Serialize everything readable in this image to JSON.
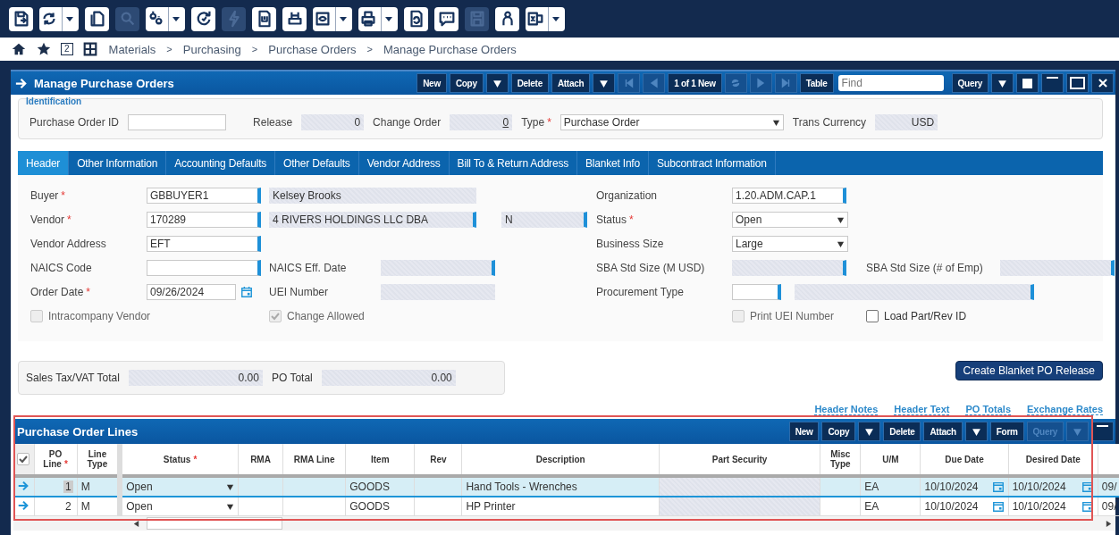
{
  "toolbar": [
    {
      "dropdown": false,
      "disabled": false
    },
    {
      "dropdown": true,
      "disabled": false
    },
    {
      "dropdown": false,
      "disabled": false
    },
    {
      "dropdown": false,
      "disabled": true
    },
    {
      "dropdown": true,
      "disabled": false
    },
    {
      "dropdown": false,
      "disabled": false
    },
    {
      "dropdown": false,
      "disabled": true
    },
    {
      "dropdown": false,
      "disabled": false
    },
    {
      "dropdown": false,
      "disabled": false
    },
    {
      "dropdown": true,
      "disabled": false
    },
    {
      "dropdown": true,
      "disabled": false
    },
    {
      "dropdown": false,
      "disabled": false
    },
    {
      "dropdown": false,
      "disabled": false
    },
    {
      "dropdown": false,
      "disabled": true
    },
    {
      "dropdown": false,
      "disabled": false
    },
    {
      "dropdown": true,
      "disabled": false
    }
  ],
  "breadcrumb": {
    "open_windows": "2",
    "items": [
      {
        "kind": "link",
        "text": "Materials"
      },
      {
        "kind": "sep",
        "text": ">"
      },
      {
        "kind": "link",
        "text": "Purchasing"
      },
      {
        "kind": "sep",
        "text": ">"
      },
      {
        "kind": "link",
        "text": "Purchase Orders"
      },
      {
        "kind": "sep",
        "text": ">"
      },
      {
        "kind": "link",
        "text": "Manage Purchase Orders"
      }
    ]
  },
  "window": {
    "title": "Manage Purchase Orders",
    "controls": [
      {
        "kind": "button",
        "label": "New",
        "disabled": false
      },
      {
        "kind": "button",
        "label": "Copy",
        "disabled": false
      },
      {
        "kind": "caret",
        "disabled": false
      },
      {
        "kind": "button",
        "label": "Delete",
        "disabled": false
      },
      {
        "kind": "button",
        "label": "Attach",
        "disabled": false
      },
      {
        "kind": "caret",
        "disabled": false
      },
      {
        "kind": "first",
        "disabled": true
      },
      {
        "kind": "prev",
        "disabled": true
      },
      {
        "kind": "button",
        "label": "1 of 1 New",
        "disabled": false
      },
      {
        "kind": "refresh",
        "disabled": true
      },
      {
        "kind": "next",
        "disabled": true
      },
      {
        "kind": "last",
        "disabled": true
      },
      {
        "kind": "button",
        "label": "Table",
        "disabled": false
      },
      {
        "kind": "find",
        "placeholder": "Find",
        "disabled": false
      },
      {
        "kind": "button",
        "label": "Query",
        "disabled": false
      },
      {
        "kind": "caret",
        "disabled": false
      },
      {
        "kind": "stop",
        "disabled": false
      },
      {
        "kind": "minimize",
        "disabled": false
      },
      {
        "kind": "maximize",
        "disabled": false
      },
      {
        "kind": "close",
        "disabled": false
      }
    ]
  },
  "identification": {
    "legend": "Identification",
    "items": [
      {
        "kind": "label",
        "text": "Purchase Order ID"
      },
      {
        "kind": "input"
      },
      {
        "kind": "label",
        "text": "Release"
      },
      {
        "kind": "readonly",
        "value": "0"
      },
      {
        "kind": "label",
        "text": "Change Order"
      },
      {
        "kind": "link",
        "value": "0"
      },
      {
        "kind": "label",
        "text": "Type",
        "required_mark": "*"
      },
      {
        "kind": "select",
        "value": "Purchase Order"
      },
      {
        "kind": "label",
        "text": "Trans Currency"
      },
      {
        "kind": "readonly",
        "value": "USD"
      }
    ]
  },
  "tabs": [
    {
      "label": "Header",
      "selected": true
    },
    {
      "label": "Other Information",
      "selected": false
    },
    {
      "label": "Accounting Defaults",
      "selected": false
    },
    {
      "label": "Other Defaults",
      "selected": false
    },
    {
      "label": "Vendor Address",
      "selected": false
    },
    {
      "label": "Bill To & Return Address",
      "selected": false
    },
    {
      "label": "Blanket Info",
      "selected": false
    },
    {
      "label": "Subcontract Information",
      "selected": false
    }
  ],
  "header_form": {
    "left": [
      {
        "kind": "label",
        "text": "Buyer",
        "required_mark": "*"
      },
      {
        "kind": "input",
        "value": "GBBUYER1",
        "lookup": true
      },
      {
        "kind": "display",
        "value": "Kelsey Brooks",
        "lookup": false
      },
      {
        "kind": "gap"
      },
      {
        "kind": "label",
        "text": "Vendor",
        "required_mark": "*"
      },
      {
        "kind": "input",
        "value": "170289",
        "lookup": true
      },
      {
        "kind": "display",
        "value": "4 RIVERS HOLDINGS LLC DBA",
        "lookup": true
      },
      {
        "kind": "readonly",
        "value": "N",
        "lookup": true
      },
      {
        "kind": "label",
        "text": "Vendor Address"
      },
      {
        "kind": "input",
        "value": "EFT",
        "lookup": true
      },
      {
        "kind": "gap"
      },
      {
        "kind": "gap"
      },
      {
        "kind": "gap"
      },
      {
        "kind": "label",
        "text": "NAICS Code"
      },
      {
        "kind": "input",
        "lookup": true
      },
      {
        "kind": "label",
        "text": "NAICS Eff. Date"
      },
      {
        "kind": "readonly",
        "lookup": true
      },
      {
        "kind": "gap"
      },
      {
        "kind": "label",
        "text": "Order Date",
        "required_mark": "*"
      },
      {
        "kind": "date",
        "value": "09/26/2024"
      },
      {
        "kind": "label",
        "text": "UEI Number"
      },
      {
        "kind": "readonly",
        "lookup": false
      },
      {
        "kind": "gap"
      },
      {
        "kind": "checkbox",
        "label": "Intracompany Vendor",
        "checked": false,
        "disabled": true
      },
      {
        "kind": "checkbox",
        "label": "Change Allowed",
        "checked": true,
        "disabled": true
      }
    ],
    "right": [
      {
        "kind": "label",
        "text": "Organization"
      },
      {
        "kind": "input",
        "value": "1.20.ADM.CAP.1",
        "lookup": true
      },
      {
        "kind": "gap"
      },
      {
        "kind": "gap"
      },
      {
        "kind": "label",
        "text": "Status",
        "required_mark": "*"
      },
      {
        "kind": "select",
        "value": "Open"
      },
      {
        "kind": "gap"
      },
      {
        "kind": "gap"
      },
      {
        "kind": "label",
        "text": "Business Size"
      },
      {
        "kind": "select",
        "value": "Large"
      },
      {
        "kind": "gap"
      },
      {
        "kind": "gap"
      },
      {
        "kind": "label",
        "text": "SBA Std Size (M USD)"
      },
      {
        "kind": "readonly",
        "lookup": true
      },
      {
        "kind": "label",
        "text": "SBA Std Size (# of Emp)"
      },
      {
        "kind": "readonly",
        "lookup": true
      },
      {
        "kind": "label",
        "text": "Procurement Type"
      },
      {
        "kind": "input",
        "lookup": true
      },
      {
        "kind": "display",
        "lookup": true
      },
      {
        "kind": "gap"
      },
      {
        "kind": "checkbox",
        "label": "Print UEI Number",
        "checked": false,
        "disabled": true
      },
      {
        "kind": "checkbox",
        "label": "Load Part/Rev ID",
        "checked": false,
        "disabled": false
      }
    ]
  },
  "totals": [
    {
      "label": "Sales Tax/VAT Total",
      "value": "0.00"
    },
    {
      "label": "PO Total",
      "value": "0.00"
    }
  ],
  "create_button": "Create Blanket PO Release",
  "links": [
    "Header Notes",
    "Header Text",
    "PO Totals",
    "Exchange Rates"
  ],
  "lines": {
    "title": "Purchase Order Lines",
    "controls": [
      {
        "kind": "button",
        "label": "New",
        "disabled": false
      },
      {
        "kind": "button",
        "label": "Copy",
        "disabled": false
      },
      {
        "kind": "caret",
        "disabled": false
      },
      {
        "kind": "button",
        "label": "Delete",
        "disabled": false
      },
      {
        "kind": "button",
        "label": "Attach",
        "disabled": false
      },
      {
        "kind": "caret",
        "disabled": false
      },
      {
        "kind": "button",
        "label": "Form",
        "disabled": false
      },
      {
        "kind": "button",
        "label": "Query",
        "disabled": true
      },
      {
        "kind": "caret",
        "disabled": true
      },
      {
        "kind": "minimize",
        "disabled": false
      }
    ],
    "select_all_checked": true,
    "columns": [
      {
        "label": "PO Line",
        "required_mark": "*"
      },
      {
        "label": "Line Type"
      },
      {
        "label": "Status",
        "required_mark": "*"
      },
      {
        "label": "RMA"
      },
      {
        "label": "RMA Line"
      },
      {
        "label": "Item"
      },
      {
        "label": "Rev"
      },
      {
        "label": "Description"
      },
      {
        "label": "Part Security"
      },
      {
        "label": "Misc Type"
      },
      {
        "label": "U/M"
      },
      {
        "label": "Due Date"
      },
      {
        "label": "Desired Date"
      }
    ],
    "rows": [
      {
        "selected": true,
        "cells": [
          {
            "kind": "number",
            "value": "1"
          },
          {
            "kind": "text",
            "value": "M"
          },
          {
            "kind": "select",
            "value": "Open"
          },
          {
            "kind": "text"
          },
          {
            "kind": "text"
          },
          {
            "kind": "text",
            "value": "GOODS"
          },
          {
            "kind": "text"
          },
          {
            "kind": "text",
            "value": "Hand Tools - Wrenches"
          },
          {
            "kind": "readonly"
          },
          {
            "kind": "text"
          },
          {
            "kind": "text",
            "value": "EA"
          },
          {
            "kind": "date",
            "value": "10/10/2024"
          },
          {
            "kind": "date",
            "value": "10/10/2024"
          },
          {
            "kind": "text",
            "value": "09/"
          }
        ]
      },
      {
        "selected": false,
        "cells": [
          {
            "kind": "number",
            "value": "2"
          },
          {
            "kind": "text",
            "value": "M"
          },
          {
            "kind": "select",
            "value": "Open"
          },
          {
            "kind": "text"
          },
          {
            "kind": "text"
          },
          {
            "kind": "text",
            "value": "GOODS"
          },
          {
            "kind": "text"
          },
          {
            "kind": "text",
            "value": "HP Printer"
          },
          {
            "kind": "readonly"
          },
          {
            "kind": "text"
          },
          {
            "kind": "text",
            "value": "EA"
          },
          {
            "kind": "date",
            "value": "10/10/2024"
          },
          {
            "kind": "date",
            "value": "10/10/2024"
          },
          {
            "kind": "text",
            "value": "09/"
          }
        ]
      }
    ]
  }
}
